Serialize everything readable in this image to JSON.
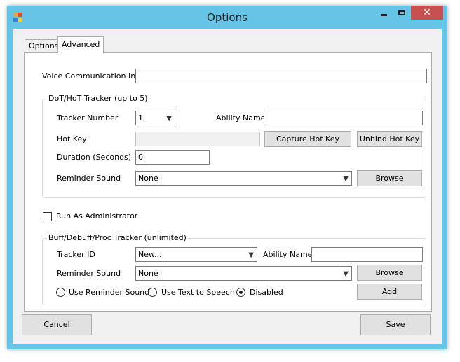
{
  "window": {
    "title": "Options",
    "close_glyph": "✕",
    "accent": "#66c4e6",
    "close_color": "#c75050"
  },
  "tabs": [
    {
      "label": "Options",
      "selected": false
    },
    {
      "label": "Advanced",
      "selected": true
    }
  ],
  "advanced": {
    "voice_label": "Voice Communication Info",
    "voice_value": "",
    "dot": {
      "group_title": "DoT/HoT Tracker (up to 5)",
      "tracker_number_label": "Tracker Number",
      "tracker_number_value": "1",
      "ability_name_label": "Ability Name",
      "ability_name_value": "",
      "hot_key_label": "Hot Key",
      "hot_key_value": "",
      "capture_button": "Capture Hot Key",
      "unbind_button": "Unbind Hot Key",
      "duration_label": "Duration (Seconds)",
      "duration_value": "0",
      "reminder_label": "Reminder Sound",
      "reminder_value": "None",
      "browse_button": "Browse"
    },
    "run_as_admin_label": "Run As Administrator",
    "run_as_admin_checked": false,
    "buff": {
      "group_title": "Buff/Debuff/Proc Tracker (unlimited)",
      "tracker_id_label": "Tracker ID",
      "tracker_id_value": "New...",
      "ability_name_label": "Ability Name",
      "ability_name_value": "",
      "reminder_label": "Reminder Sound",
      "reminder_value": "None",
      "browse_button": "Browse",
      "radio_reminder": "Use Reminder Sound",
      "radio_tts": "Use Text to Speech",
      "radio_disabled": "Disabled",
      "selected_radio": "Disabled",
      "add_button": "Add"
    }
  },
  "footer": {
    "cancel_button": "Cancel",
    "save_button": "Save"
  }
}
